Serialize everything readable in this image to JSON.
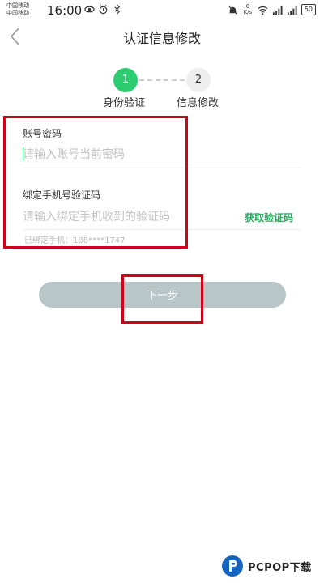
{
  "status_bar": {
    "carrier_1": "中国移动",
    "carrier_2": "中国移动",
    "time": "16:00",
    "net_speed_value": "0",
    "net_speed_unit": "K/s",
    "battery": "50"
  },
  "header": {
    "title": "认证信息修改",
    "back_icon": "chevron-left-icon"
  },
  "steps": [
    {
      "number": "1",
      "label": "身份验证",
      "active": true
    },
    {
      "number": "2",
      "label": "信息修改",
      "active": false
    }
  ],
  "form": {
    "password_label": "账号密码",
    "password_placeholder": "请输入账号当前密码",
    "sms_label": "绑定手机号验证码",
    "sms_placeholder": "请输入绑定手机收到的验证码",
    "get_code_label": "获取验证码",
    "bound_phone_text": "已绑定手机：188****1747"
  },
  "next_button_label": "下一步",
  "watermark": {
    "text": "PCPOP下载"
  },
  "colors": {
    "accent_green": "#2ecc71",
    "link_green": "#27ae60",
    "button_disabled": "#b9c6c8",
    "annotation_red": "#d0021b"
  }
}
